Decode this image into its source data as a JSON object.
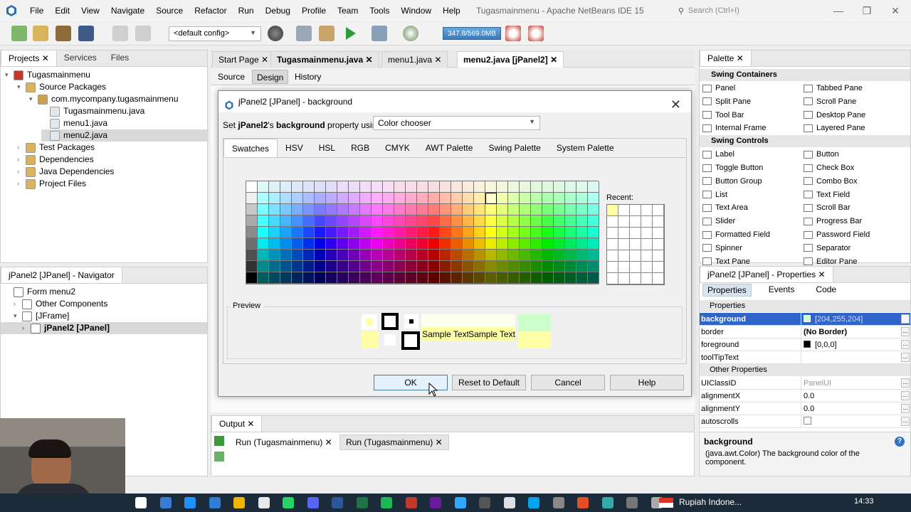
{
  "menubar": {
    "items": [
      "File",
      "Edit",
      "View",
      "Navigate",
      "Source",
      "Refactor",
      "Run",
      "Debug",
      "Profile",
      "Team",
      "Tools",
      "Window",
      "Help"
    ]
  },
  "window": {
    "title": "Tugasmainmenu - Apache NetBeans IDE 15",
    "search_placeholder": "Search (Ctrl+I)"
  },
  "toolbar": {
    "config": "<default config>",
    "memory": "347.8/569.0MB"
  },
  "projects": {
    "tabs": [
      "Projects",
      "Services",
      "Files"
    ],
    "tree": [
      {
        "label": "Tugasmainmenu",
        "indent": 0,
        "toggle": "▾",
        "icon": "project-icon"
      },
      {
        "label": "Source Packages",
        "indent": 1,
        "toggle": "▾",
        "icon": "folder-icon"
      },
      {
        "label": "com.mycompany.tugasmainmenu",
        "indent": 2,
        "toggle": "▾",
        "icon": "package-icon"
      },
      {
        "label": "Tugasmainmenu.java",
        "indent": 3,
        "toggle": "",
        "icon": "java-file-icon"
      },
      {
        "label": "menu1.java",
        "indent": 3,
        "toggle": "",
        "icon": "form-file-icon"
      },
      {
        "label": "menu2.java",
        "indent": 3,
        "toggle": "",
        "icon": "form-file-icon",
        "selected": true
      },
      {
        "label": "Test Packages",
        "indent": 1,
        "toggle": "›",
        "icon": "folder-icon"
      },
      {
        "label": "Dependencies",
        "indent": 1,
        "toggle": "›",
        "icon": "folder-icon"
      },
      {
        "label": "Java Dependencies",
        "indent": 1,
        "toggle": "›",
        "icon": "folder-icon"
      },
      {
        "label": "Project Files",
        "indent": 1,
        "toggle": "›",
        "icon": "folder-icon"
      }
    ]
  },
  "navigator": {
    "title": "jPanel2 [JPanel] - Navigator",
    "tree": [
      {
        "label": "Form menu2",
        "indent": 0,
        "toggle": ""
      },
      {
        "label": "Other Components",
        "indent": 1,
        "toggle": "›"
      },
      {
        "label": "[JFrame]",
        "indent": 1,
        "toggle": "▾"
      },
      {
        "label": "jPanel2 [JPanel]",
        "indent": 2,
        "toggle": "›",
        "selected": true
      }
    ]
  },
  "editor": {
    "tabs": [
      "Start Page",
      "Tugasmainmenu.java",
      "menu1.java",
      "menu2.java [jPanel2]"
    ],
    "modes": [
      "Source",
      "Design",
      "History"
    ]
  },
  "dialog": {
    "title": "jPanel2 [JPanel] - background",
    "set_prefix": "Set ",
    "set_component": "jPanel2",
    "set_mid": "'s ",
    "set_prop": "background",
    "set_suffix": " property using:",
    "method": "Color chooser",
    "tabs": [
      "Swatches",
      "HSV",
      "HSL",
      "RGB",
      "CMYK",
      "AWT Palette",
      "Swing Palette",
      "System Palette"
    ],
    "recent_label": "Recent:",
    "preview_label": "Preview",
    "sample_text_1": "Sample Text",
    "sample_text_2": "Sample Text",
    "buttons": {
      "ok": "OK",
      "reset": "Reset to Default",
      "cancel": "Cancel",
      "help": "Help"
    },
    "selected_color": "#ccffcc"
  },
  "palette": {
    "title": "Palette",
    "sections": [
      {
        "name": "Swing Containers",
        "items": [
          [
            "Panel",
            "Tabbed Pane"
          ],
          [
            "Split Pane",
            "Scroll Pane"
          ],
          [
            "Tool Bar",
            "Desktop Pane"
          ],
          [
            "Internal Frame",
            "Layered Pane"
          ]
        ]
      },
      {
        "name": "Swing Controls",
        "items": [
          [
            "Label",
            "Button"
          ],
          [
            "Toggle Button",
            "Check Box"
          ],
          [
            "Button Group",
            "Combo Box"
          ],
          [
            "List",
            "Text Field"
          ],
          [
            "Text Area",
            "Scroll Bar"
          ],
          [
            "Slider",
            "Progress Bar"
          ],
          [
            "Formatted Field",
            "Password Field"
          ],
          [
            "Spinner",
            "Separator"
          ],
          [
            "Text Pane",
            "Editor Pane"
          ]
        ]
      }
    ]
  },
  "properties": {
    "title": "jPanel2 [JPanel] - Properties",
    "tabs": [
      "Properties",
      "Events",
      "Code"
    ],
    "section_main": "Properties",
    "rows": [
      {
        "name": "background",
        "value": "[204,255,204]",
        "swatch": "#ccffcc",
        "selected": true
      },
      {
        "name": "border",
        "value": "(No Border)",
        "bold": true
      },
      {
        "name": "foreground",
        "value": "[0,0,0]",
        "swatch": "#000000"
      },
      {
        "name": "toolTipText",
        "value": ""
      }
    ],
    "section_other": "Other Properties",
    "other_rows": [
      {
        "name": "UIClassID",
        "value": "PanelUI",
        "grey": true
      },
      {
        "name": "alignmentX",
        "value": "0.0"
      },
      {
        "name": "alignmentY",
        "value": "0.0"
      },
      {
        "name": "autoscrolls",
        "value": "",
        "checkbox": true
      }
    ],
    "desc_title": "background",
    "desc_text": "(java.awt.Color) The background color of the component."
  },
  "output": {
    "title": "Output",
    "tabs": [
      "Run (Tugasmainmenu)",
      "Run (Tugasmainmenu)"
    ]
  },
  "taskbar": {
    "tray_text": "Rupiah Indone...",
    "time": "14:33"
  }
}
